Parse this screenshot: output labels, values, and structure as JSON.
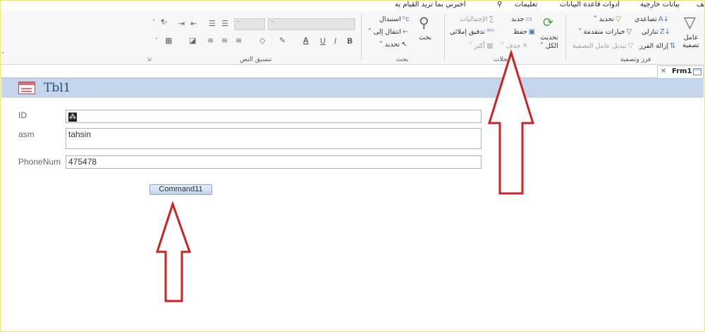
{
  "menu": {
    "items": [
      "ملف",
      "بيانات خارجية",
      "أدوات قاعدة البيانات",
      "تعليمات"
    ],
    "tell_me": "أخبرني بما تريد القيام به"
  },
  "ribbon": {
    "sort_filter": {
      "label": "فرز وتصفية",
      "filter": "عامل تصفية",
      "ascending": "تصاعدي",
      "descending": "تنازلي",
      "remove_sort": "إزالة الفرز",
      "selection": "تحديد",
      "advanced": "خيارات متقدمة",
      "toggle_filter": "تبديل عامل التصفية"
    },
    "records": {
      "label": "سجلات",
      "refresh": "تحديث",
      "refresh_all": "الكل",
      "new": "جديد",
      "save": "حفظ",
      "delete": "حذف",
      "totals": "الإجماليات",
      "spelling": "تدقيق إملائي",
      "more": "أكثر"
    },
    "find": {
      "label": "بحث",
      "find": "بحث",
      "replace": "استبدال",
      "goto": "انتقال إلى",
      "select": "تحديد"
    },
    "text_format": {
      "label": "تنسيق النص"
    }
  },
  "tab": {
    "label": "Frm1"
  },
  "form": {
    "title": "Tbl1",
    "fields": [
      {
        "label": "ID",
        "value": ""
      },
      {
        "label": "asm",
        "value": "tahsin"
      },
      {
        "label": "PhoneNum",
        "value": "475478"
      }
    ],
    "command_button": "Command11"
  },
  "colors": {
    "annotation_arrow": "#cc2222",
    "form_header": "#c5d6ec",
    "border": "#f2ea4a"
  }
}
